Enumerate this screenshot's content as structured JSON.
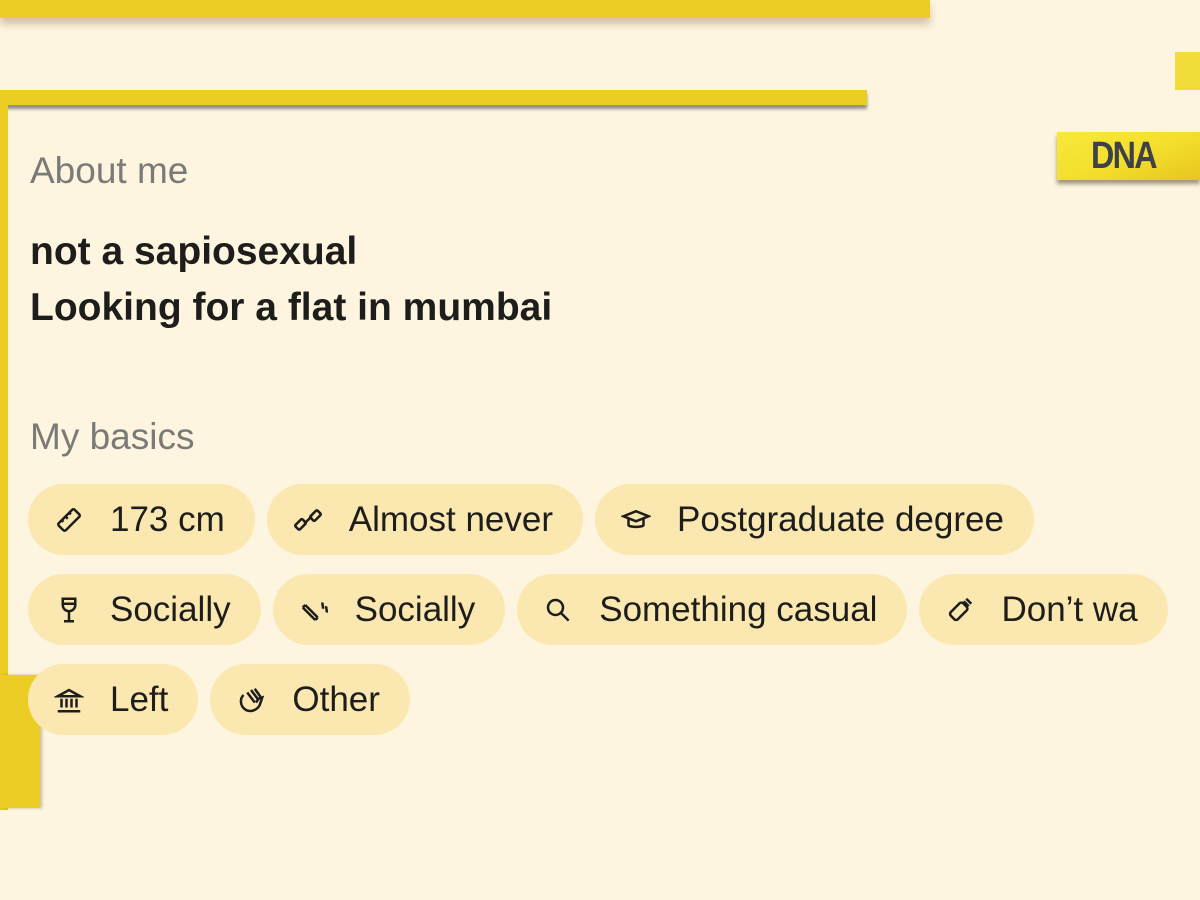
{
  "brand": {
    "logo_text": "DNA",
    "accent_color": "#eccd25",
    "background_color": "#fdf5df",
    "chip_color": "#fbe8b0"
  },
  "about": {
    "label": "About me",
    "lines": [
      "not a sapiosexual",
      "Looking for a flat in mumbai"
    ]
  },
  "basics": {
    "label": "My basics",
    "chips": [
      {
        "icon": "ruler-icon",
        "label": "173 cm"
      },
      {
        "icon": "dumbbell-icon",
        "label": "Almost never"
      },
      {
        "icon": "graduation-cap-icon",
        "label": "Postgraduate degree"
      },
      {
        "icon": "wine-glass-icon",
        "label": "Socially"
      },
      {
        "icon": "cigarette-icon",
        "label": "Socially"
      },
      {
        "icon": "magnifier-icon",
        "label": "Something casual"
      },
      {
        "icon": "baby-bottle-icon",
        "label": "Don’t wa"
      },
      {
        "icon": "government-building-icon",
        "label": "Left"
      },
      {
        "icon": "praying-hands-icon",
        "label": "Other"
      }
    ]
  }
}
